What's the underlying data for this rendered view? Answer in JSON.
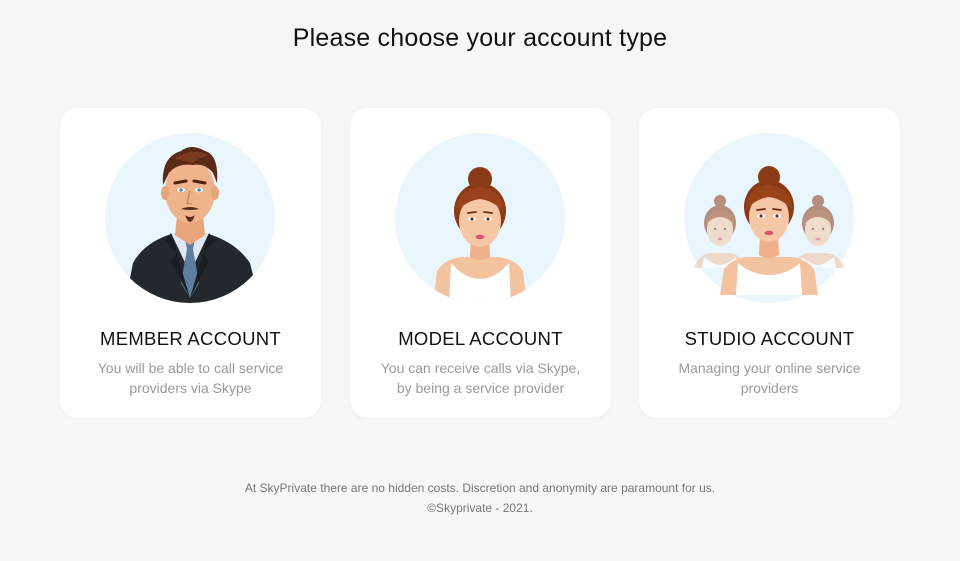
{
  "page": {
    "title": "Please choose your account type"
  },
  "cards": [
    {
      "title": "MEMBER ACCOUNT",
      "description": "You will be able to call service providers via Skype",
      "icon": "man-avatar-icon"
    },
    {
      "title": "MODEL ACCOUNT",
      "description": "You can receive calls via Skype, by being a service provider",
      "icon": "woman-avatar-icon"
    },
    {
      "title": "STUDIO ACCOUNT",
      "description": "Managing your online service providers",
      "icon": "group-avatar-icon"
    }
  ],
  "footer": {
    "line1": "At SkyPrivate there are no hidden costs. Discretion and anonymity are paramount for us.",
    "line2": "©Skyprivate - 2021."
  },
  "colors": {
    "background": "#f7f7f7",
    "card": "#ffffff",
    "avatar_circle": "#eaf6fd",
    "title_text": "#111111",
    "desc_text": "#9a9a9a"
  }
}
